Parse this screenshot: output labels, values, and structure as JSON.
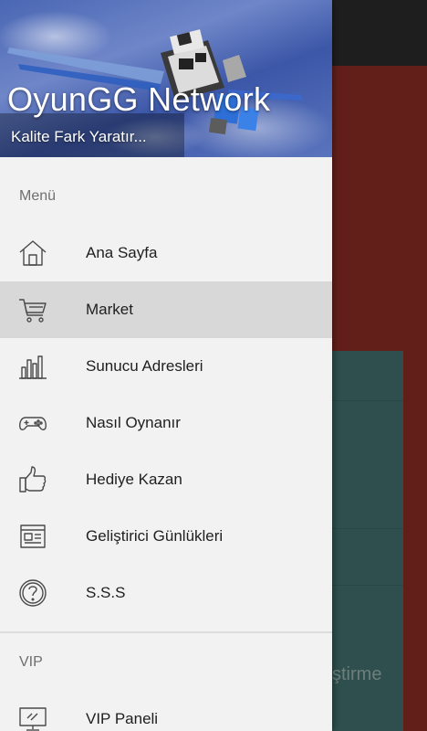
{
  "header": {
    "title": "OyunGG Network",
    "subtitle": "Kalite Fark Yaratır..."
  },
  "sections": {
    "menu_label": "Menü",
    "vip_label": "VIP"
  },
  "menu_items": [
    {
      "label": "Ana Sayfa",
      "icon": "home-icon",
      "active": false
    },
    {
      "label": "Market",
      "icon": "cart-icon",
      "active": true
    },
    {
      "label": "Sunucu Adresleri",
      "icon": "bar-chart-icon",
      "active": false
    },
    {
      "label": "Nasıl Oynanır",
      "icon": "gamepad-icon",
      "active": false
    },
    {
      "label": "Hediye Kazan",
      "icon": "thumbs-up-icon",
      "active": false
    },
    {
      "label": "Geliştirici Günlükleri",
      "icon": "newspaper-icon",
      "active": false
    },
    {
      "label": "S.S.S",
      "icon": "question-icon",
      "active": false
    }
  ],
  "vip_items": [
    {
      "label": "VIP Paneli",
      "icon": "monitor-icon",
      "active": false
    }
  ],
  "background": {
    "card_text": "ştirme"
  },
  "colors": {
    "drawer_bg": "#f2f2f2",
    "active_item_bg": "#d8d8d8",
    "scrim_app_bg": "#621f1a",
    "card_bg": "#2e4f4d",
    "icon_stroke": "#4a4a4a"
  }
}
